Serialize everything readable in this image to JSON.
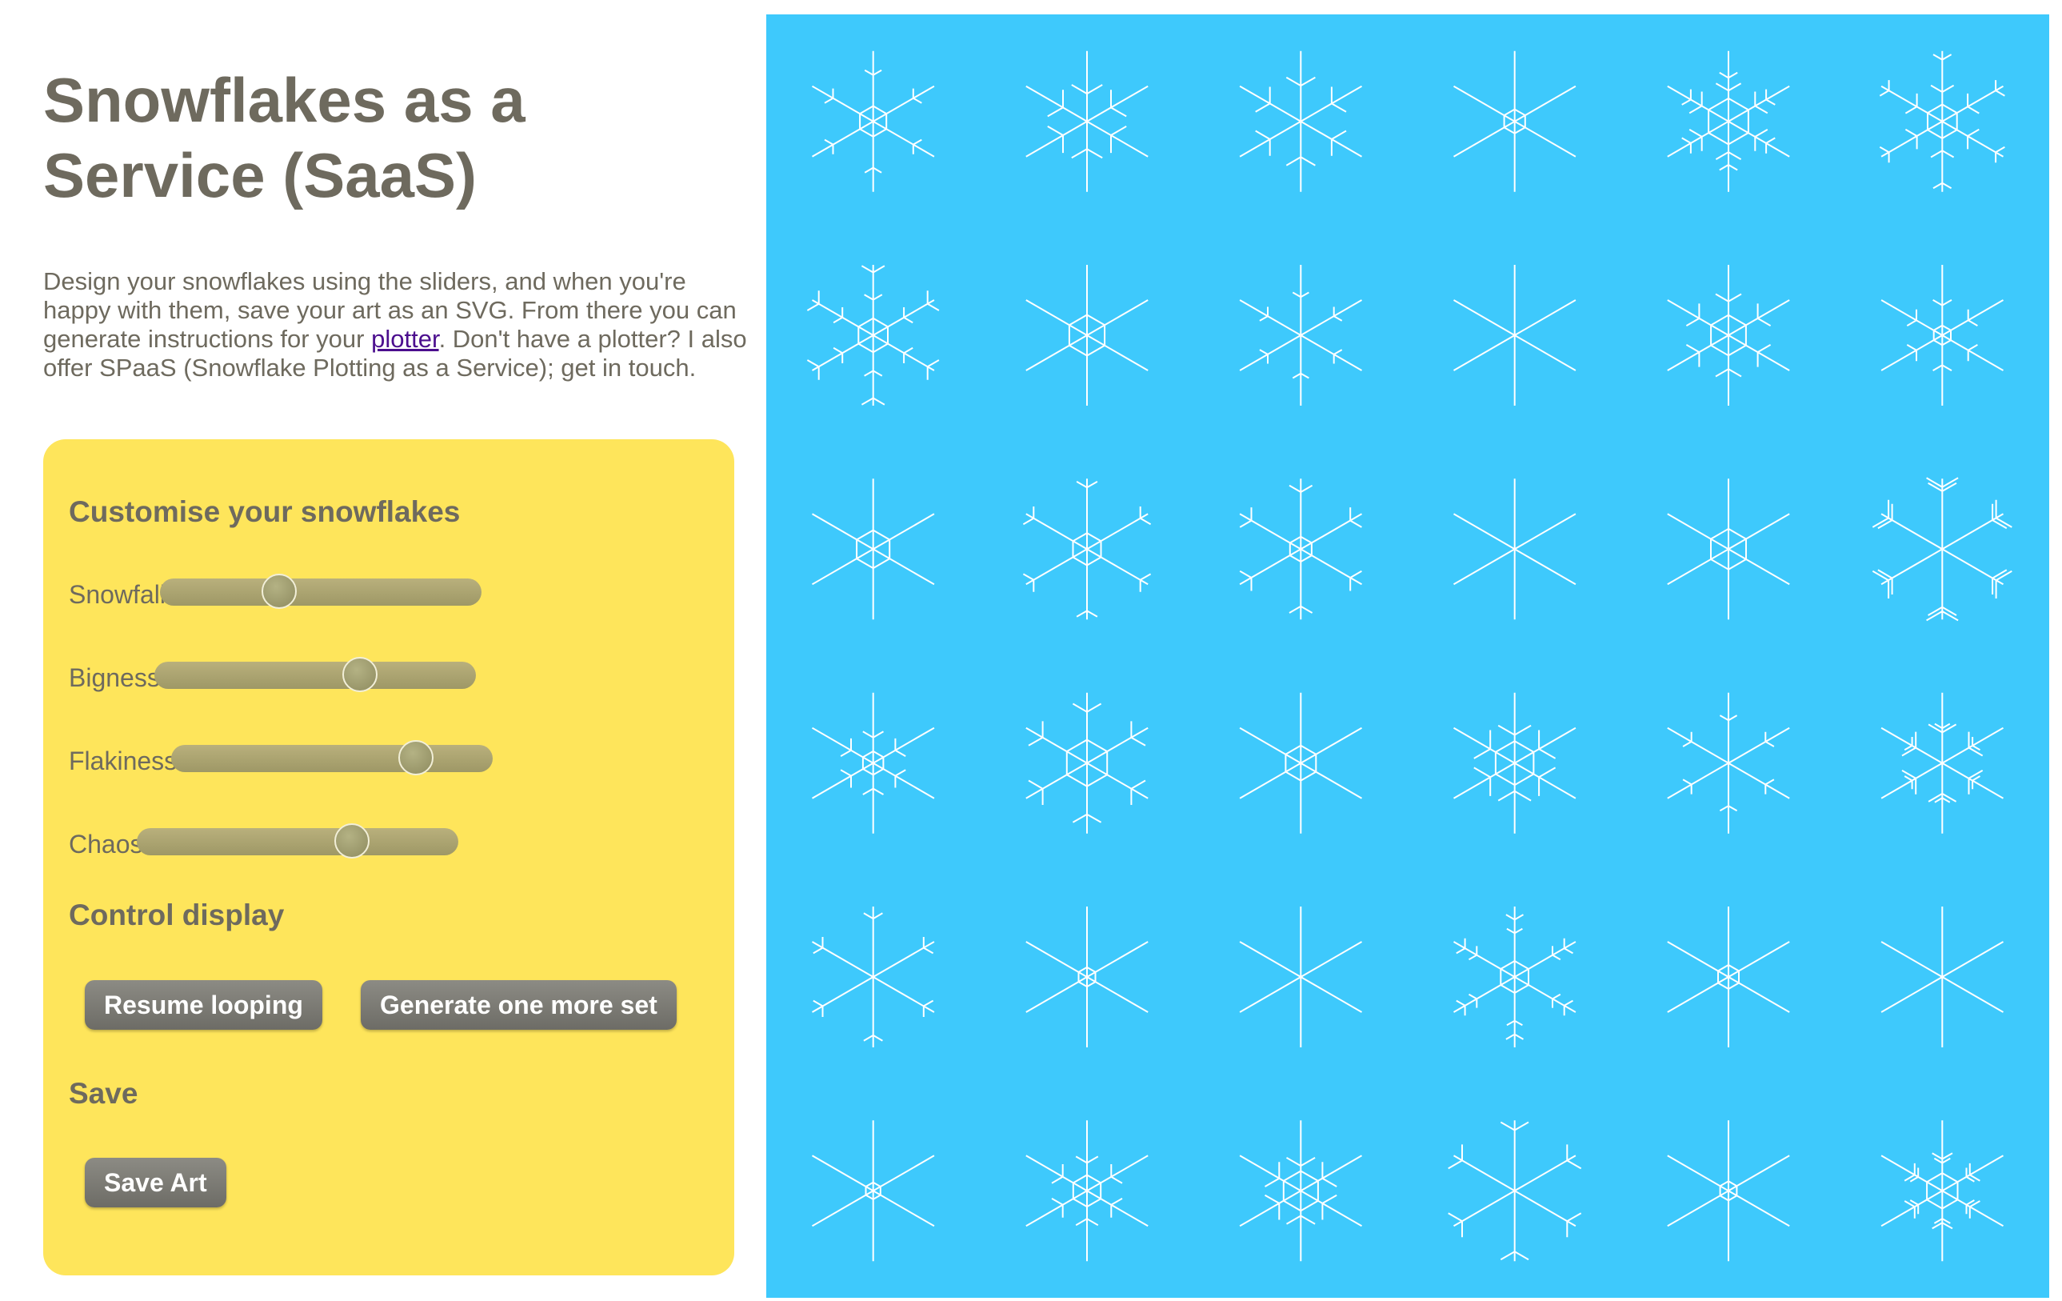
{
  "page": {
    "title": "Snowflakes as a Service (SaaS)",
    "intro_before_link": "Design your snowflakes using the sliders, and when you're happy with them, save your art as an SVG. From there you can generate instructions for your ",
    "intro_link": "plotter",
    "intro_after_link": ". Don't have a plotter? I also offer SPaaS (Snowflake Plotting as a Service); get in touch."
  },
  "controls": {
    "heading": "Customise your snowflakes",
    "sliders": [
      {
        "label": "Snowfall:",
        "value": 0.37
      },
      {
        "label": "Bigness:",
        "value": 0.64
      },
      {
        "label": "Flakiness:",
        "value": 0.76
      },
      {
        "label": "Chaos:",
        "value": 0.67
      }
    ]
  },
  "display": {
    "heading": "Control display",
    "resume_label": "Resume looping",
    "generate_label": "Generate one more set"
  },
  "save": {
    "heading": "Save",
    "save_label": "Save Art"
  },
  "colors": {
    "canvas_background": "#3ec9fc",
    "panel_background": "#fee55b",
    "text": "#6e6a5e",
    "flake_stroke": "#ffffff"
  },
  "snowflakes": {
    "rows": 6,
    "columns": 6
  }
}
